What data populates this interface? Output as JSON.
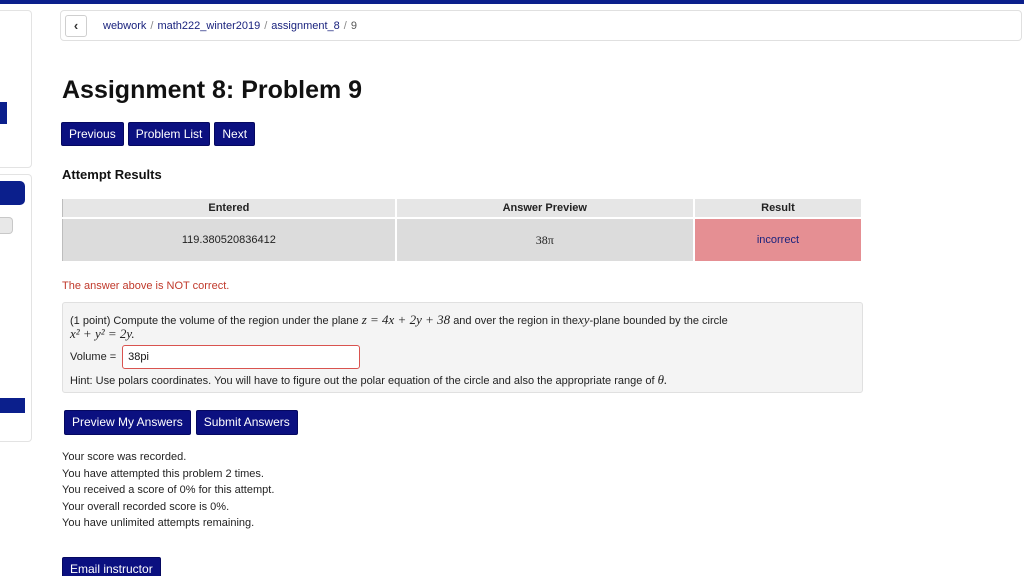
{
  "breadcrumb": {
    "back_icon": "chevron-left-icon",
    "items": [
      "webwork",
      "math222_winter2019",
      "assignment_8",
      "9"
    ],
    "separator": "/"
  },
  "page_title": "Assignment 8: Problem 9",
  "nav": {
    "previous": "Previous",
    "problem_list": "Problem List",
    "next": "Next"
  },
  "results": {
    "title": "Attempt Results",
    "headers": [
      "Entered",
      "Answer Preview",
      "Result"
    ],
    "row": {
      "entered": "119.380520836412",
      "preview": "38π",
      "result": "incorrect"
    },
    "status_message": "The answer above is NOT correct."
  },
  "problem": {
    "points": "(1 point)",
    "text_a": "Compute the volume of the region under the plane",
    "plane_eq": "z = 4x + 2y + 38",
    "text_b": "and over the region in the",
    "plane_name": "xy",
    "text_c": "-plane bounded by the circle",
    "circle_eq": "x² + y² = 2y.",
    "volume_label": "Volume =",
    "volume_value": "38pi",
    "hint_text": "Hint: Use polars coordinates. You will have to figure out the polar equation of the circle and also the appropriate range of",
    "theta": "θ."
  },
  "actions": {
    "preview": "Preview My Answers",
    "submit": "Submit Answers"
  },
  "score_lines": [
    "Your score was recorded.",
    "You have attempted this problem 2 times.",
    "You received a score of 0% for this attempt.",
    "Your overall recorded score is 0%.",
    "You have unlimited attempts remaining."
  ],
  "email_instructor": "Email instructor",
  "colors": {
    "accent": "#0b1080",
    "incorrect_bg": "#e58f93",
    "error_text": "#c0392b"
  }
}
